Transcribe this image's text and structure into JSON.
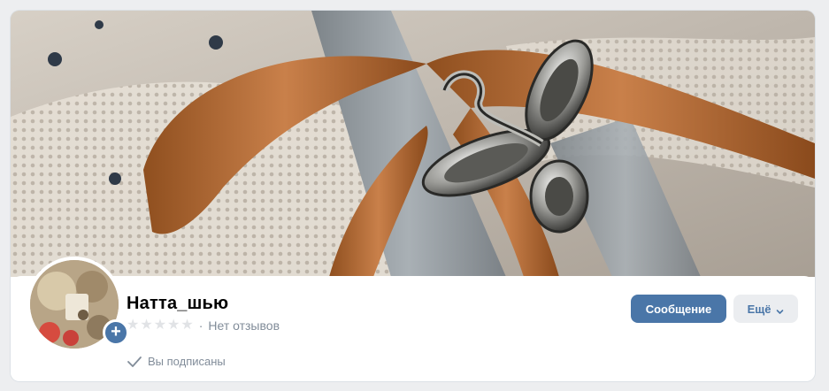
{
  "profile": {
    "name": "Натта_шью",
    "rating_text": "Нет отзывов",
    "rating_stars_filled": 0,
    "rating_stars_total": 5,
    "subscribed_text": "Вы подписаны"
  },
  "actions": {
    "message_label": "Сообщение",
    "more_label": "Ещё"
  },
  "icons": {
    "avatar_add": "plus-icon",
    "subscribed": "check-icon",
    "more": "chevron-down-icon",
    "star": "star-icon"
  },
  "colors": {
    "accent": "#4a76a8",
    "secondary_bg": "#ebedf0",
    "muted_text": "#818c99",
    "star_empty": "#e1e3e6",
    "page_bg": "#edeef0"
  }
}
